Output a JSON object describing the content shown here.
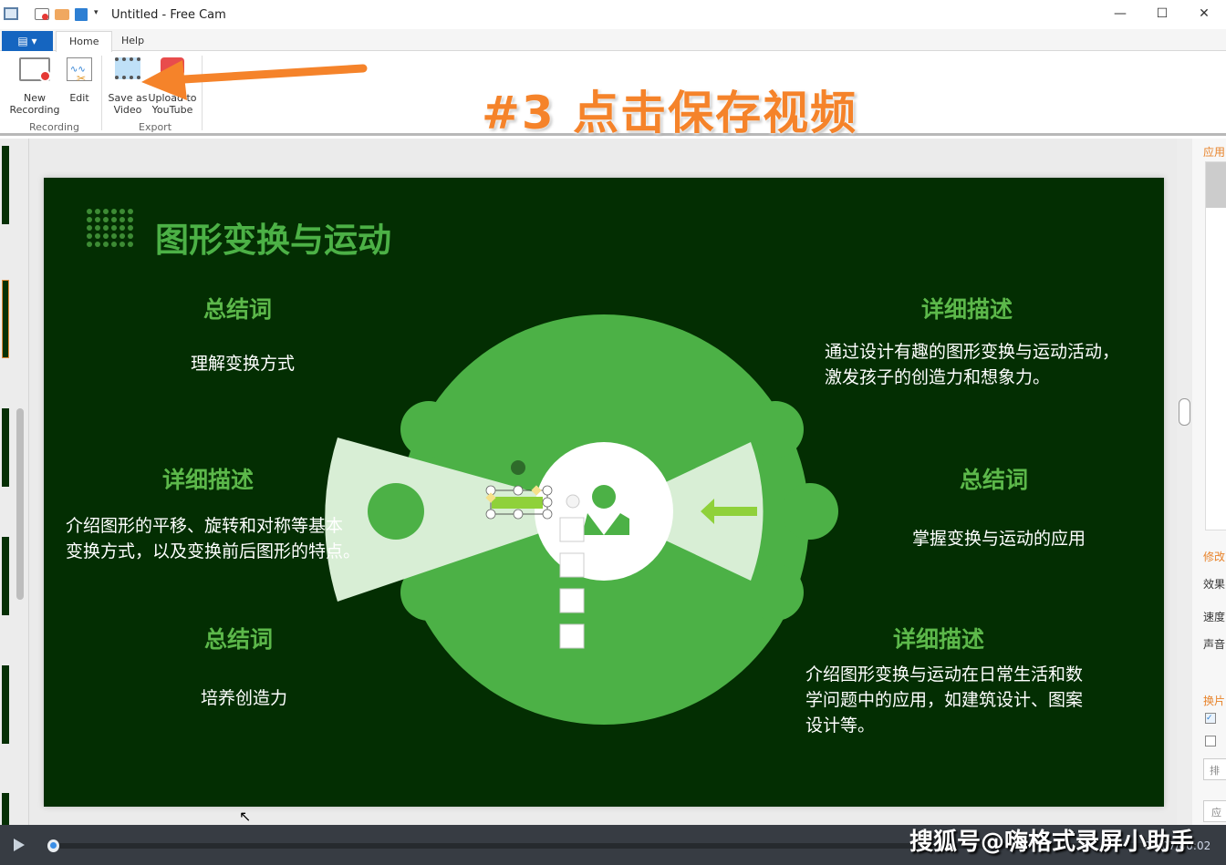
{
  "window": {
    "title": "Untitled - Free Cam",
    "minimize": "—",
    "maximize": "☐",
    "close": "✕"
  },
  "tabs": [
    {
      "label": "Home",
      "active": true
    },
    {
      "label": "Help"
    }
  ],
  "ribbon": {
    "groups": [
      {
        "label": "Recording"
      },
      {
        "label": "Export"
      }
    ],
    "buttons": {
      "new_recording": "New\nRecording",
      "edit": "Edit",
      "save_as_video": "Save as\nVideo",
      "upload_youtube": "Upload to\nYouTube"
    }
  },
  "annotation": "#3 点击保存视频",
  "slide": {
    "title": "图形变换与运动",
    "blocks": [
      {
        "heading": "总结词",
        "text": "理解变换方式"
      },
      {
        "heading": "详细描述",
        "text": "介绍图形的平移、旋转和对称等基本\n变换方式，以及变换前后图形的特点。"
      },
      {
        "heading": "总结词",
        "text": "培养创造力"
      },
      {
        "heading": "详细描述",
        "text": "通过设计有趣的图形变换与运动活动，\n激发孩子的创造力和想象力。"
      },
      {
        "heading": "总结词",
        "text": "掌握变换与运动的应用"
      },
      {
        "heading": "详细描述",
        "text": "介绍图形变换与运动在日常生活和数\n学问题中的应用，如建筑设计、图案\n设计等。"
      }
    ],
    "colors": {
      "background": "#032e02",
      "green": "#4cb146",
      "light": "#d8eed5",
      "arrow": "#8fd13a"
    }
  },
  "right_panel": {
    "items": [
      "应用",
      "修改",
      "效果",
      "速度",
      "声音",
      "换片",
      "排",
      "应"
    ]
  },
  "player": {
    "time": "00:07/00:02",
    "watermark": "搜狐号@嗨格式录屏小助手",
    "progress": 0
  }
}
